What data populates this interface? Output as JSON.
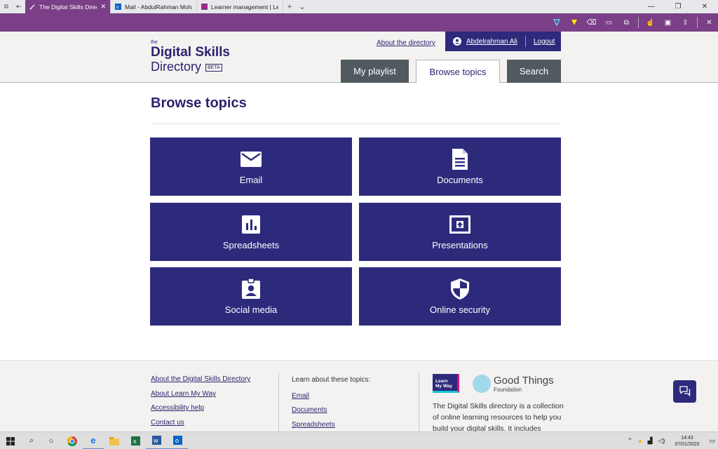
{
  "browser": {
    "tabs": [
      {
        "title": "The Digital Skills Directo",
        "active": true
      },
      {
        "title": "Mail - AbdulRahman Mohar",
        "active": false
      },
      {
        "title": "Learner management | Lear",
        "active": false
      }
    ],
    "window_controls": [
      "—",
      "❐",
      "✕"
    ]
  },
  "header": {
    "logo_the": "the",
    "logo_line1": "Digital Skills",
    "logo_line2": "Directory",
    "beta": "BETA",
    "about_link": "About the directory",
    "user_name": "Abdelrahman Ali",
    "logout": "Logout",
    "nav": {
      "my_playlist": "My playlist",
      "browse_topics": "Browse topics",
      "search": "Search"
    }
  },
  "main": {
    "title": "Browse topics",
    "topics": [
      {
        "label": "Email",
        "icon": "envelope-icon"
      },
      {
        "label": "Documents",
        "icon": "document-icon"
      },
      {
        "label": "Spreadsheets",
        "icon": "bar-chart-icon"
      },
      {
        "label": "Presentations",
        "icon": "presentation-icon"
      },
      {
        "label": "Social media",
        "icon": "contact-badge-icon"
      },
      {
        "label": "Online security",
        "icon": "shield-icon"
      }
    ]
  },
  "footer": {
    "links": [
      "About the Digital Skills Directory",
      "About Learn My Way",
      "Accessibility help",
      "Contact us"
    ],
    "topics_heading": "Learn about these topics:",
    "topic_links": [
      "Email",
      "Documents",
      "Spreadsheets"
    ],
    "lmw_line1": "Learn",
    "lmw_line2": "My Way",
    "gtf_name": "Good Things",
    "gtf_sub": "Foundation",
    "blurb": "The Digital Skills directory is a collection of online learning resources to help you build your digital skills. It includes"
  },
  "taskbar": {
    "time": "14:43",
    "date": "07/01/2020"
  },
  "colors": {
    "brand_navy": "#2d2a7c",
    "browser_purple": "#7a3f86"
  }
}
